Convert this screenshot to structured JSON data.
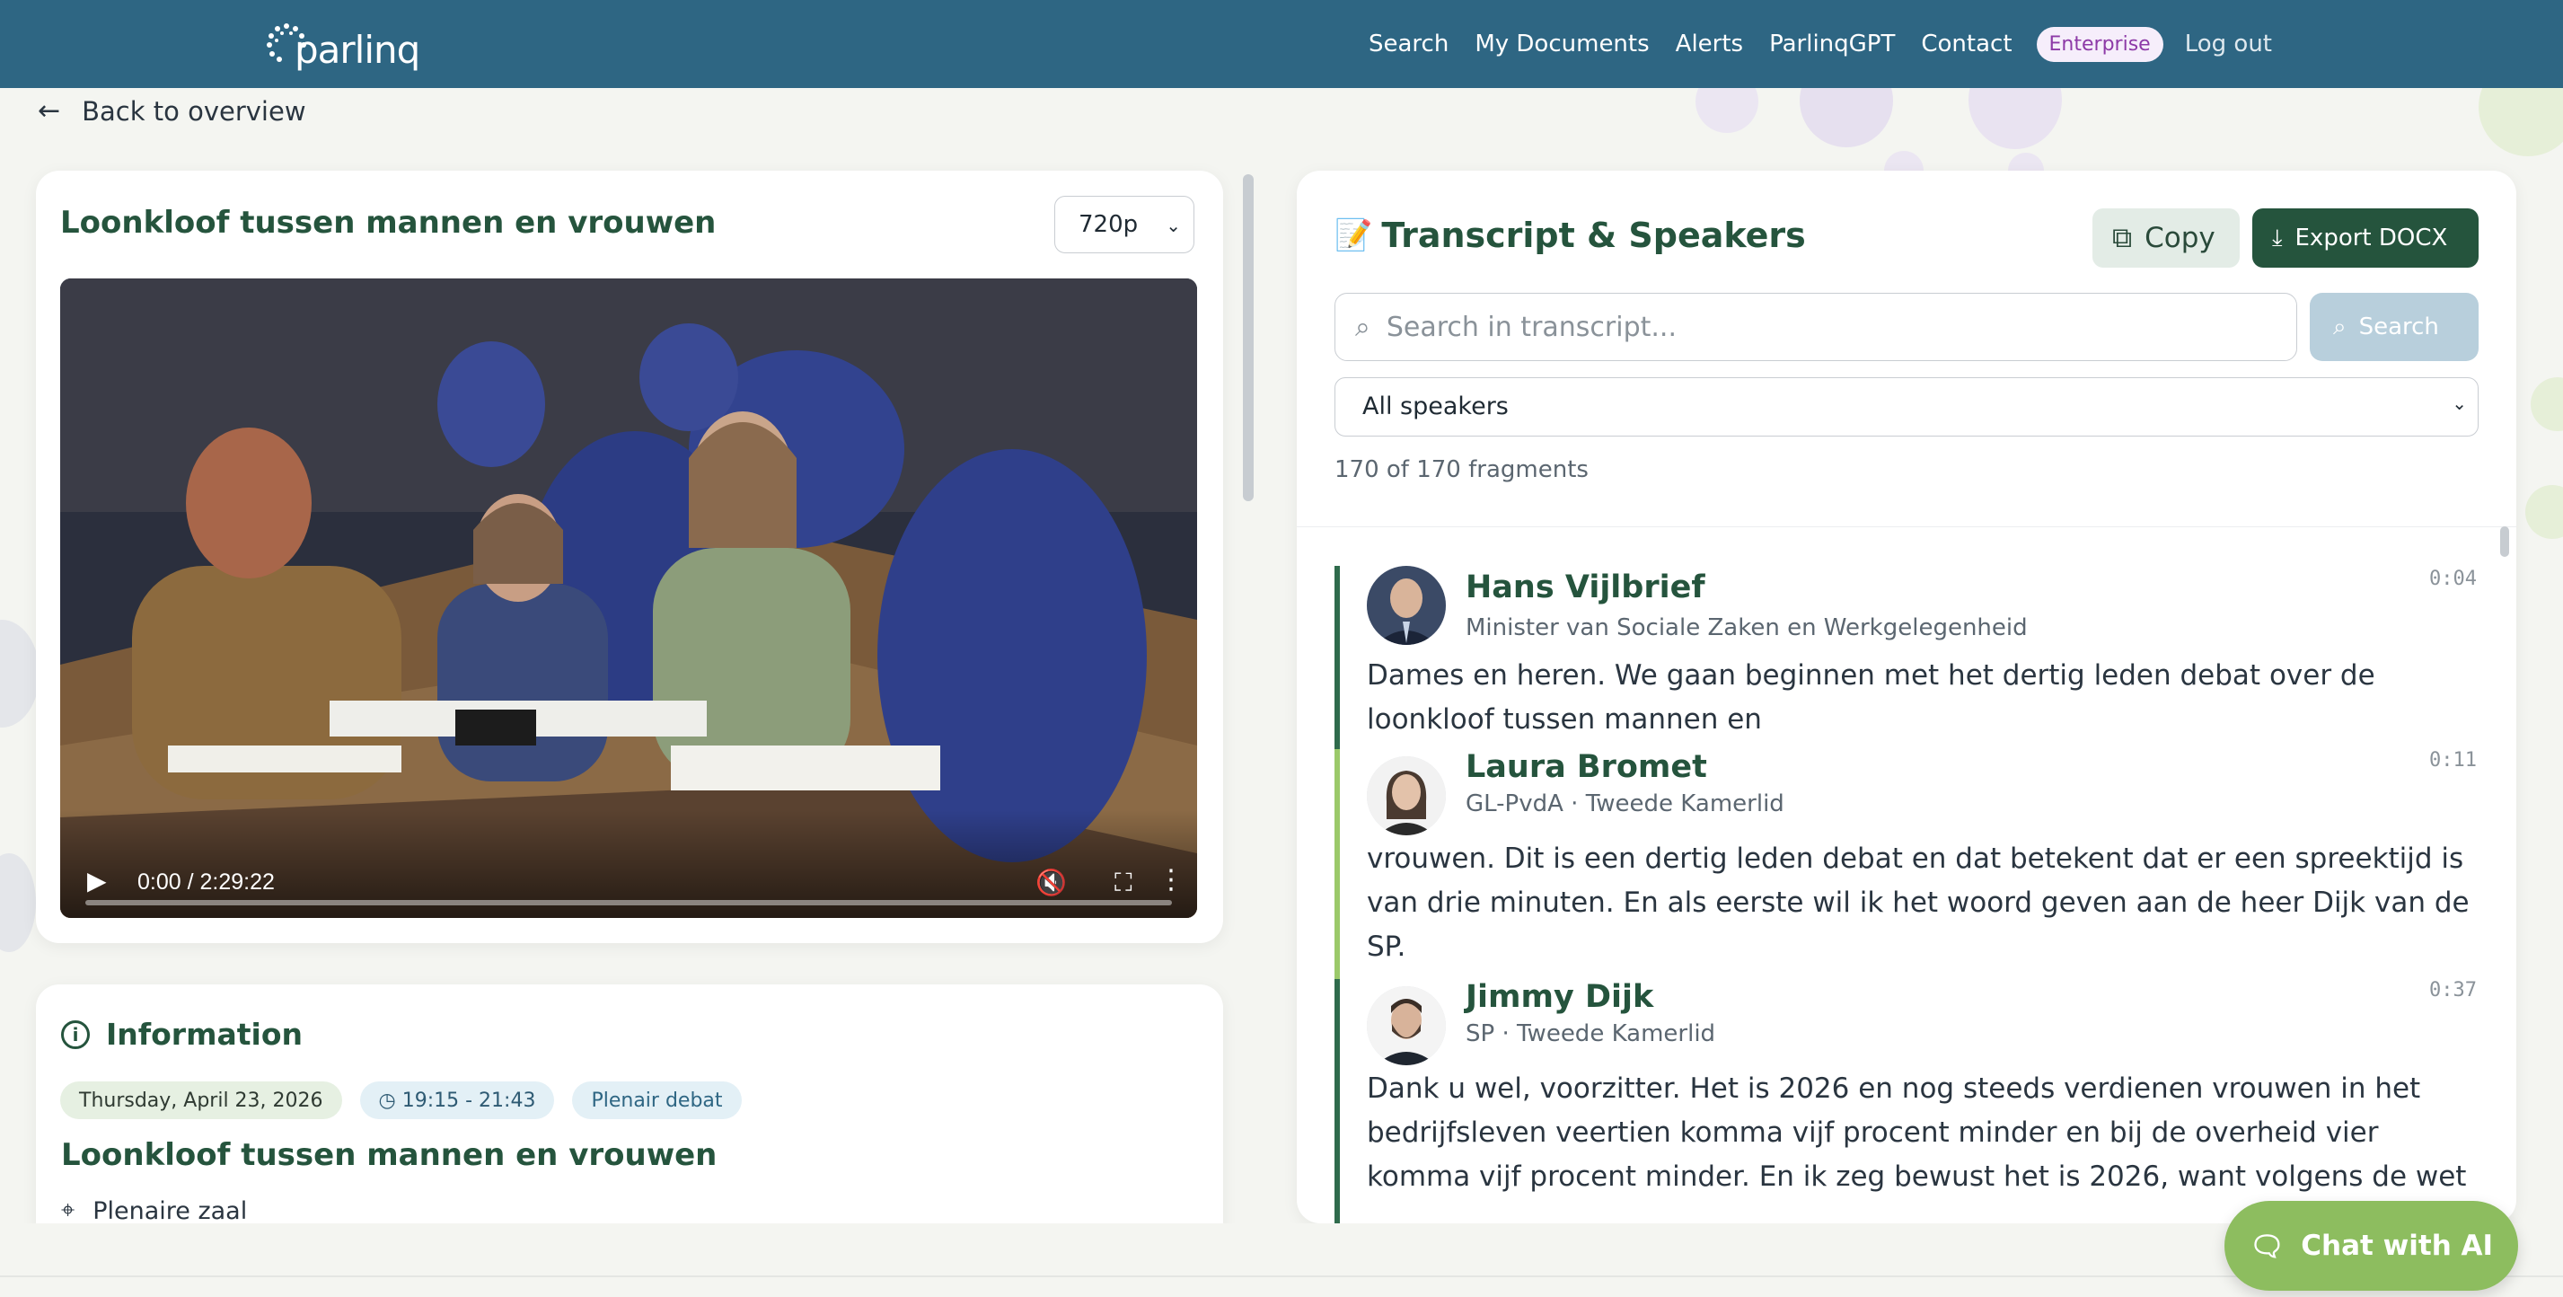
{
  "header": {
    "logo_text": "parlinq",
    "nav": [
      "Search",
      "My Documents",
      "Alerts",
      "ParlinqGPT",
      "Contact"
    ],
    "badge": "Enterprise",
    "logout": "Log out"
  },
  "back_link": "Back to overview",
  "video": {
    "title": "Loonkloof tussen mannen en vrouwen",
    "quality": "720p",
    "time": "0:00 / 2:29:22",
    "progress": 0
  },
  "info": {
    "heading": "Information",
    "date": "Thursday, April 23, 2026",
    "time": "19:15 - 21:43",
    "type": "Plenair debat",
    "title": "Loonkloof tussen mannen en vrouwen",
    "location": "Plenaire zaal"
  },
  "transcript": {
    "heading": "Transcript & Speakers",
    "copy_label": "Copy",
    "export_label": "Export DOCX",
    "search_placeholder": "Search in transcript...",
    "search_button": "Search",
    "speaker_filter": "All speakers",
    "fragment_count": "170 of 170 fragments",
    "fragments": [
      {
        "name": "Hans Vijlbrief",
        "role": "Minister van Sociale Zaken en Werkgelegenheid",
        "time": "0:04",
        "text": "Dames en heren. We gaan beginnen met het dertig leden debat over de loonkloof tussen mannen en"
      },
      {
        "name": "Laura Bromet",
        "role": "GL-PvdA · Tweede Kamerlid",
        "time": "0:11",
        "text": "vrouwen. Dit is een dertig leden debat en dat betekent dat er een spreektijd is van drie minuten. En als eerste wil ik het woord geven aan de heer Dijk van de SP."
      },
      {
        "name": "Jimmy Dijk",
        "role": "SP · Tweede Kamerlid",
        "time": "0:37",
        "text": "Dank u wel, voorzitter. Het is 2026 en nog steeds verdienen vrouwen in het bedrijfsleven veertien komma vijf procent minder en bij de overheid vier komma vijf procent minder. En ik zeg bewust het is 2026, want volgens de wet"
      }
    ]
  },
  "chat_button": "Chat with AI",
  "colors": {
    "header_bg": "#2e6683",
    "accent_green": "#25543d",
    "chat_green": "#8dbd5f",
    "badge_purple": "#8d3aa7"
  }
}
